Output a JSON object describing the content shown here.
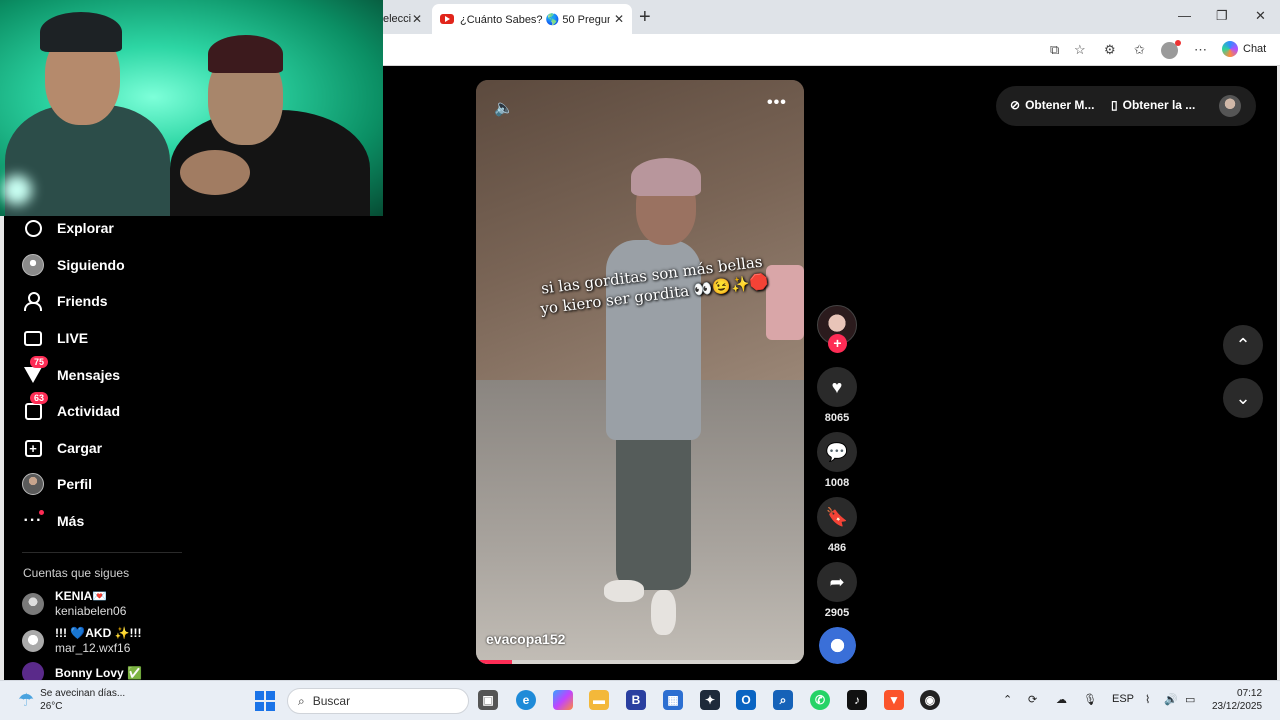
{
  "browser": {
    "tabs": [
      {
        "title": "elecci"
      },
      {
        "title": "¿Cuánto Sabes? 🌎 50 Preguntas"
      }
    ],
    "chat_label": "Chat"
  },
  "sidebar": {
    "items": [
      {
        "label": "Explorar",
        "icon": "compass-icon"
      },
      {
        "label": "Siguiendo",
        "icon": "avatar-icon"
      },
      {
        "label": "Friends",
        "icon": "friends-icon"
      },
      {
        "label": "LIVE",
        "icon": "live-tv-icon"
      },
      {
        "label": "Mensajes",
        "icon": "send-icon",
        "badge": "75"
      },
      {
        "label": "Actividad",
        "icon": "inbox-icon",
        "badge": "63"
      },
      {
        "label": "Cargar",
        "icon": "plus-square-icon"
      },
      {
        "label": "Perfil",
        "icon": "profile-avatar"
      },
      {
        "label": "Más",
        "icon": "more-icon"
      }
    ],
    "following_title": "Cuentas que sigues",
    "following": [
      {
        "display": "KENIA💌",
        "handle": "keniabelen06"
      },
      {
        "display": "!!! 💙AKD ✨!!!",
        "handle": "mar_12.wxf16"
      },
      {
        "display": "Bonny Lovy ✅",
        "handle": ""
      }
    ]
  },
  "video": {
    "caption": "si las gorditas son más bellas yo kiero ser gordita 👀😉✨🛑",
    "author": "evacopa152",
    "progress_fraction": 0.11
  },
  "actions": {
    "likes": "8065",
    "comments": "1008",
    "saves": "486",
    "shares": "2905"
  },
  "top_right": {
    "get_m_label": "Obtener M...",
    "get_app_label": "Obtener la ..."
  },
  "taskbar": {
    "weather_text": "Se avecinan días...",
    "weather_temp": "26°C",
    "search_placeholder": "Buscar",
    "lang": "ESP",
    "time": "07:12",
    "date": "23/12/2025"
  },
  "colors": {
    "accent": "#fe2c55",
    "background": "#000000",
    "webcam_green": "#2dd6a4"
  }
}
